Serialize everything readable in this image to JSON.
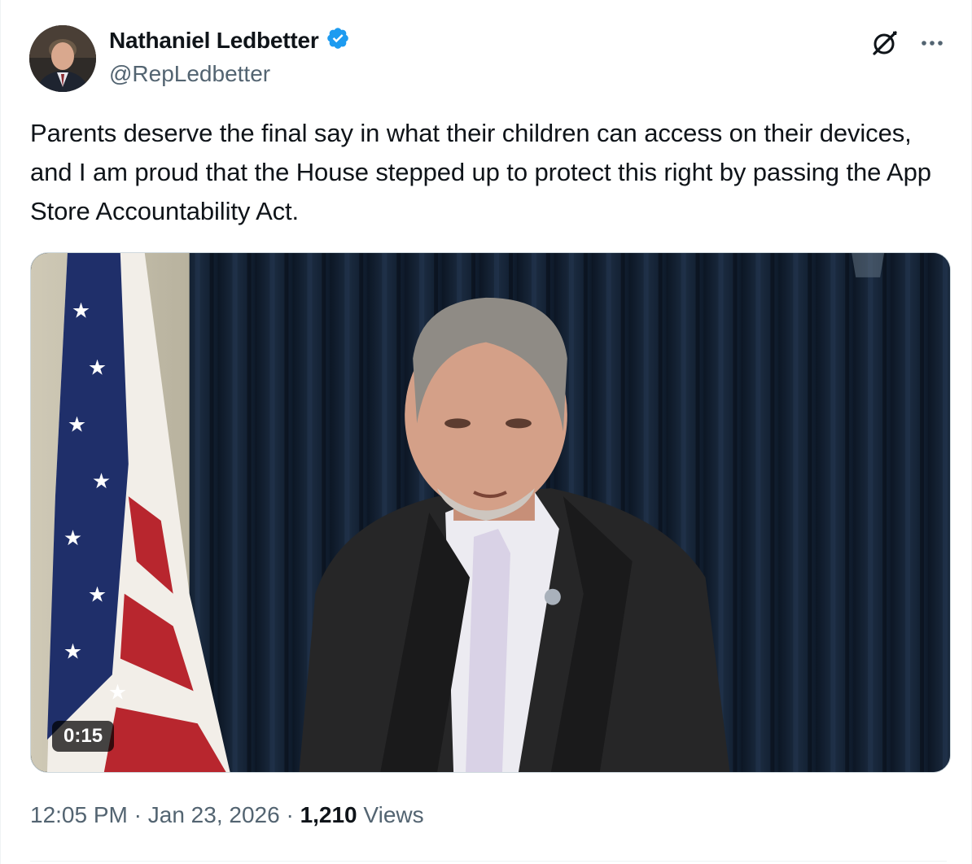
{
  "author": {
    "display_name": "Nathaniel Ledbetter",
    "handle": "@RepLedbetter",
    "verified_badge_color": "#1d9bf0"
  },
  "icons": {
    "verified": "verified-badge-icon",
    "grok": "grok-icon",
    "more": "more-horizontal-icon"
  },
  "tweet": {
    "text": "Parents deserve the final say in what their children can access on their devices, and I am proud that the House stepped up to protect this right by passing the App Store Accountability Act."
  },
  "media": {
    "type": "video",
    "duration": "0:15"
  },
  "meta": {
    "time": "12:05 PM",
    "separator": "·",
    "date": "Jan 23, 2026",
    "views_count": "1,210",
    "views_label": "Views"
  },
  "colors": {
    "text_primary": "#0f1419",
    "text_secondary": "#536471",
    "accent": "#1d9bf0"
  }
}
